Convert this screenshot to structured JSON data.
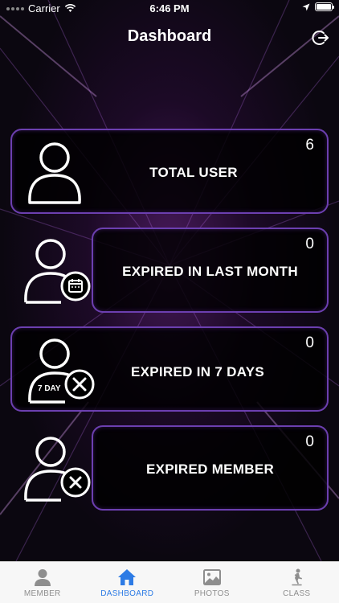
{
  "status_bar": {
    "carrier": "Carrier",
    "time": "6:46 PM"
  },
  "header": {
    "title": "Dashboard"
  },
  "cards": [
    {
      "label": "TOTAL USER",
      "count": "6"
    },
    {
      "label": "EXPIRED IN LAST MONTH",
      "count": "0"
    },
    {
      "label": "EXPIRED IN 7 DAYS",
      "count": "0",
      "icon_badge": "7 DAY"
    },
    {
      "label": "EXPIRED MEMBER",
      "count": "0"
    }
  ],
  "tab_bar": {
    "tabs": [
      {
        "label": "MEMBER",
        "icon": "person-icon",
        "active": false
      },
      {
        "label": "DASHBOARD",
        "icon": "home-icon",
        "active": true
      },
      {
        "label": "PHOTOS",
        "icon": "photos-icon",
        "active": false
      },
      {
        "label": "CLASS",
        "icon": "skater-icon",
        "active": false
      }
    ]
  },
  "colors": {
    "card_border": "#6c3fb0",
    "tab_active": "#2d7be5",
    "tab_inactive": "#8e8e8e"
  }
}
